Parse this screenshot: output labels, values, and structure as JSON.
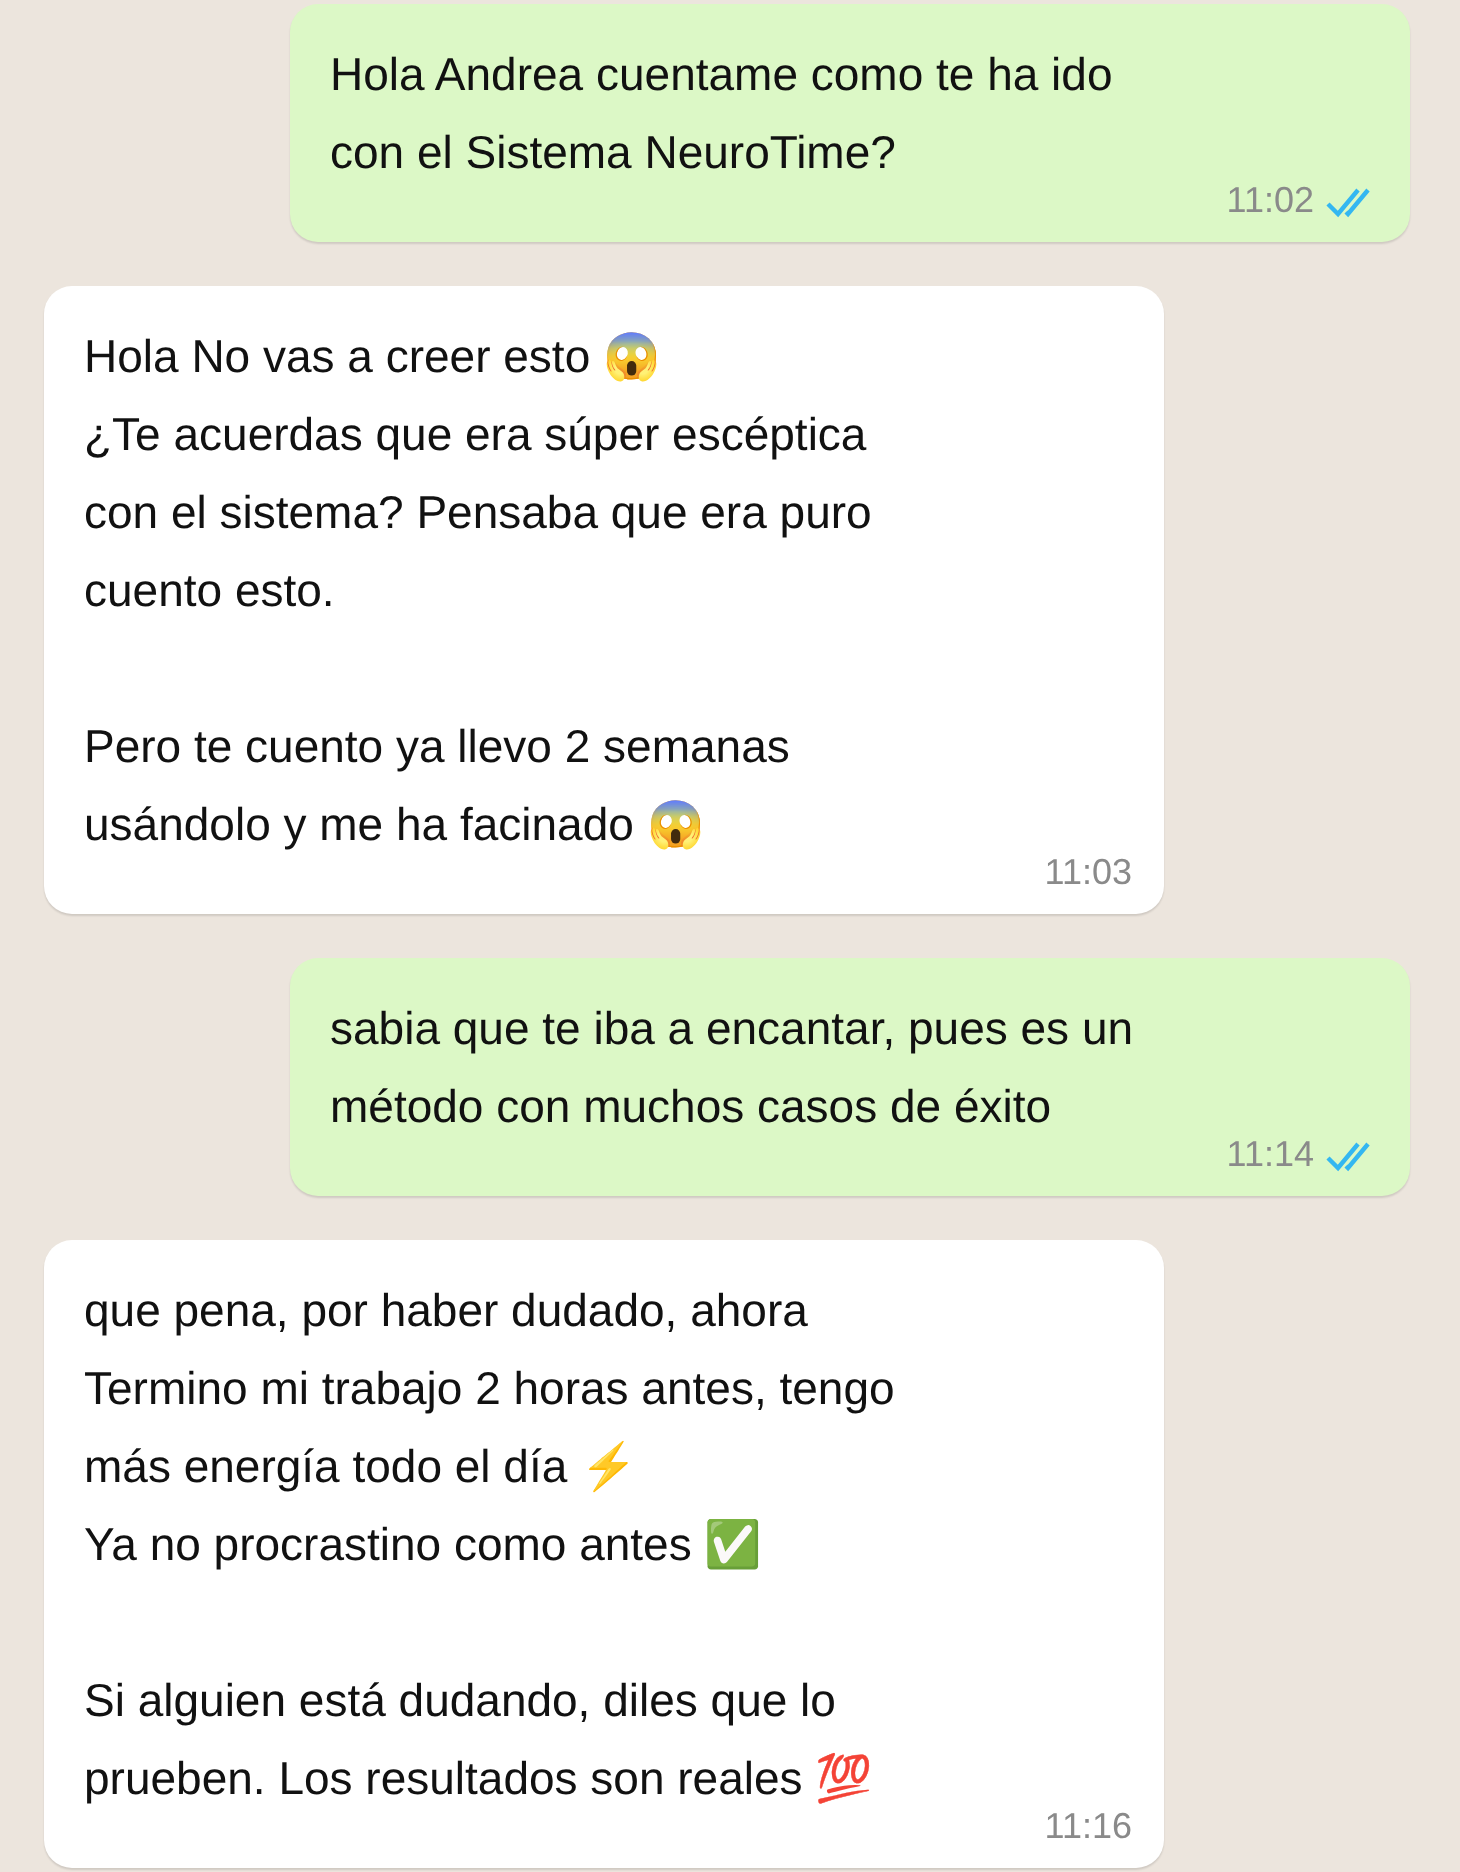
{
  "messages": [
    {
      "kind": "outgoing",
      "text": "Hola Andrea cuentame como te ha ido\ncon el Sistema NeuroTime?",
      "time": "11:02",
      "read": true
    },
    {
      "kind": "incoming",
      "text": "Hola No vas a creer esto 😱\n¿Te acuerdas que era súper escéptica\ncon el sistema? Pensaba que era puro\ncuento esto.\n\nPero te cuento ya llevo 2 semanas\nusándolo y me ha facinado 😱",
      "time": "11:03"
    },
    {
      "kind": "outgoing",
      "text": "sabia que te iba a encantar, pues es un\nmétodo con muchos casos de éxito",
      "time": "11:14",
      "read": true
    },
    {
      "kind": "incoming",
      "text": "que pena, por haber dudado, ahora\nTermino mi trabajo 2 horas antes, tengo\nmás energía todo el día ⚡\nYa no procrastino como antes ✅\n\nSi alguien está dudando, diles que lo\nprueben. Los resultados son reales 💯",
      "time": "11:16"
    }
  ]
}
